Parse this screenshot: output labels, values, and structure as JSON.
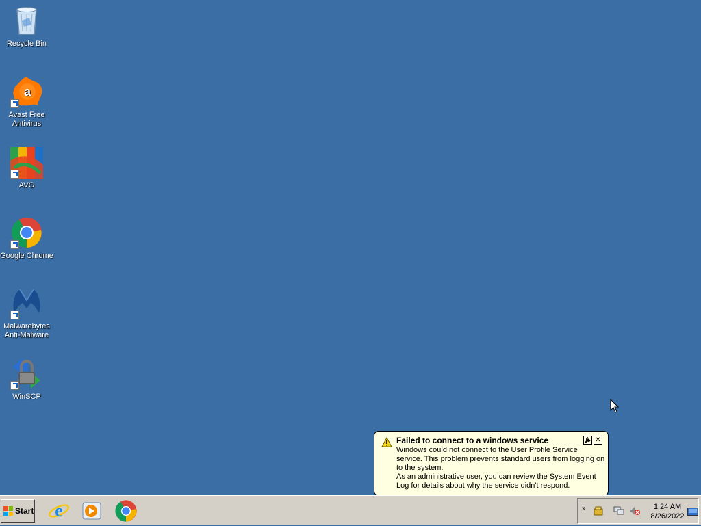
{
  "desktop": {
    "icons": [
      {
        "label": "Recycle Bin",
        "icon": "recycle-bin-icon"
      },
      {
        "label": "Avast Free Antivirus",
        "icon": "avast-icon"
      },
      {
        "label": "AVG",
        "icon": "avg-icon"
      },
      {
        "label": "Google Chrome",
        "icon": "chrome-icon"
      },
      {
        "label": "Malwarebytes Anti-Malware",
        "icon": "malwarebytes-icon"
      },
      {
        "label": "WinSCP",
        "icon": "winscp-icon"
      }
    ]
  },
  "taskbar": {
    "start_label": "Start",
    "quick_launch": [
      "internet-explorer-icon",
      "media-player-icon",
      "chrome-icon"
    ],
    "clock": {
      "time": "1:24 AM",
      "date": "8/26/2022"
    },
    "tray_expand": "»"
  },
  "balloon": {
    "title": "Failed to connect to a windows service",
    "line1": "Windows could not connect to the User Profile Service service. This problem prevents standard users from logging on to the system.",
    "line2": "As an administrative user, you can review the System Event Log for details about why the service didn't respond.",
    "close_glyph": "✕"
  },
  "colors": {
    "desktop_bg": "#3a6ea5",
    "taskbar_bg": "#d4d0c8",
    "balloon_bg": "#ffffe1"
  }
}
